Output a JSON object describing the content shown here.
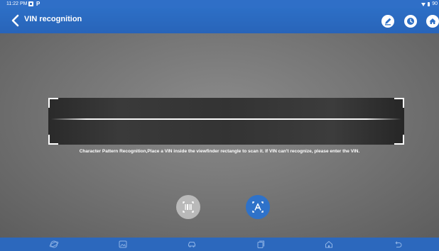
{
  "status_bar": {
    "time": "11:22 PM",
    "app_icon": "square-app-icon",
    "p_icon": "P",
    "battery": "90"
  },
  "header": {
    "title": "VIN recognition",
    "back_icon": "chevron-left-icon",
    "actions": [
      {
        "name": "edit-action",
        "icon": "pencil-icon"
      },
      {
        "name": "history-action",
        "icon": "clock-icon"
      },
      {
        "name": "home-action",
        "icon": "home-icon"
      }
    ]
  },
  "scanner": {
    "instruction": "Character Pattern Recognition,Place a VIN inside the viewfinder rectangle to scan it. If VIN can't recognize, please enter the VIN.",
    "modes": [
      {
        "name": "barcode-mode",
        "icon": "barcode-icon",
        "active": false
      },
      {
        "name": "text-mode",
        "icon": "text-recognition-icon",
        "active": true
      }
    ]
  },
  "nav_bar": {
    "buttons": [
      "browser-icon",
      "gallery-icon",
      "car-icon",
      "recent-apps-icon",
      "home-icon",
      "back-icon"
    ]
  },
  "colors": {
    "accent": "#2f6fc7",
    "inactive_button": "#b9b9b9",
    "camera_background": "#777777",
    "viewfinder": "#333333"
  }
}
